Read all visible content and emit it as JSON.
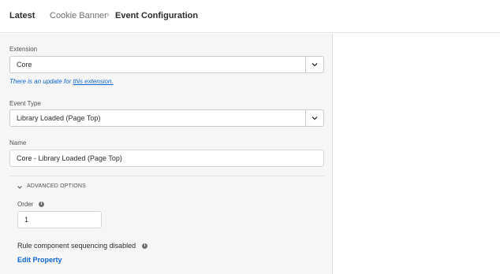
{
  "breadcrumb": {
    "root": "Latest",
    "parent": "Cookie Banner",
    "separator": "›",
    "current": "Event Configuration"
  },
  "form": {
    "extension": {
      "label": "Extension",
      "value": "Core"
    },
    "update_note": {
      "prefix": "There is an update for ",
      "link": "this extension."
    },
    "event_type": {
      "label": "Event Type",
      "value": "Library Loaded (Page Top)"
    },
    "name": {
      "label": "Name",
      "value": "Core - Library Loaded (Page Top)"
    },
    "advanced": {
      "label": "ADVANCED OPTIONS",
      "order_label": "Order",
      "order_value": "1"
    },
    "rule_sequencing": "Rule component sequencing disabled",
    "edit_property": "Edit Property"
  },
  "icons": {
    "chevron": "chevron-down-icon",
    "info": "info-icon"
  },
  "colors": {
    "link": "#0d66d0",
    "panel_bg": "#f6f6f6"
  }
}
